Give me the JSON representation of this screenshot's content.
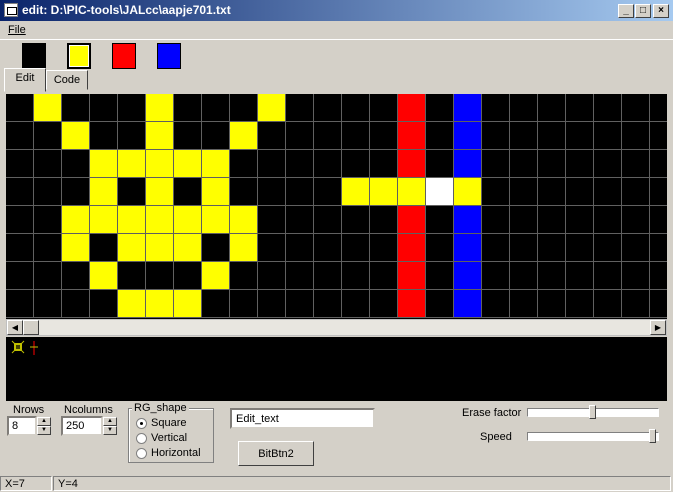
{
  "window": {
    "title": "edit: D:\\PIC-tools\\JALcc\\aapje701.txt",
    "controls": [
      "_",
      "□",
      "×"
    ]
  },
  "menu": {
    "file_label": "File"
  },
  "palette": {
    "colors": [
      {
        "name": "black",
        "color": "#000000",
        "selected": false
      },
      {
        "name": "yellow",
        "color": "#ffff00",
        "selected": true
      },
      {
        "name": "red",
        "color": "#ff0000",
        "selected": false
      },
      {
        "name": "blue",
        "color": "#0000ff",
        "selected": false
      }
    ]
  },
  "tabs": [
    {
      "label": "Edit",
      "active": true
    },
    {
      "label": "Code",
      "active": false
    }
  ],
  "grid": {
    "rows": 8,
    "columns": 24,
    "legend": {
      "0": "#000000",
      "Y": "#ffff00",
      "R": "#ff0000",
      "B": "#0000ff",
      "W": "#ffffff"
    },
    "cells": [
      "0Y000Y000Y0000R0B0000000",
      "00Y00Y00Y00000R0B0000000",
      "000YYYYY000000R0B0000000",
      "000Y0Y0Y0000YYYWY0000000",
      "00YYYYYYY00000R0B0000000",
      "00Y0YYY0Y00000R0B0000000",
      "000Y000Y000000R0B0000000",
      "0000YYY0000000R0B0000000"
    ]
  },
  "controls": {
    "nrows_label": "Nrows",
    "nrows_value": "8",
    "ncolumns_label": "Ncolumns",
    "ncolumns_value": "250",
    "rg_shape_label": "RG_shape",
    "rg_shape_options": [
      {
        "label": "Square",
        "selected": true
      },
      {
        "label": "Vertical",
        "selected": false
      },
      {
        "label": "Horizontal",
        "selected": false
      }
    ],
    "edit_text_value": "Edit_text",
    "bitbtn_label": "BitBtn2",
    "erase_factor_label": "Erase factor",
    "erase_factor_value": 0.5,
    "speed_label": "Speed",
    "speed_value": 0.98
  },
  "status": {
    "x": "X=7",
    "y": "Y=4"
  }
}
